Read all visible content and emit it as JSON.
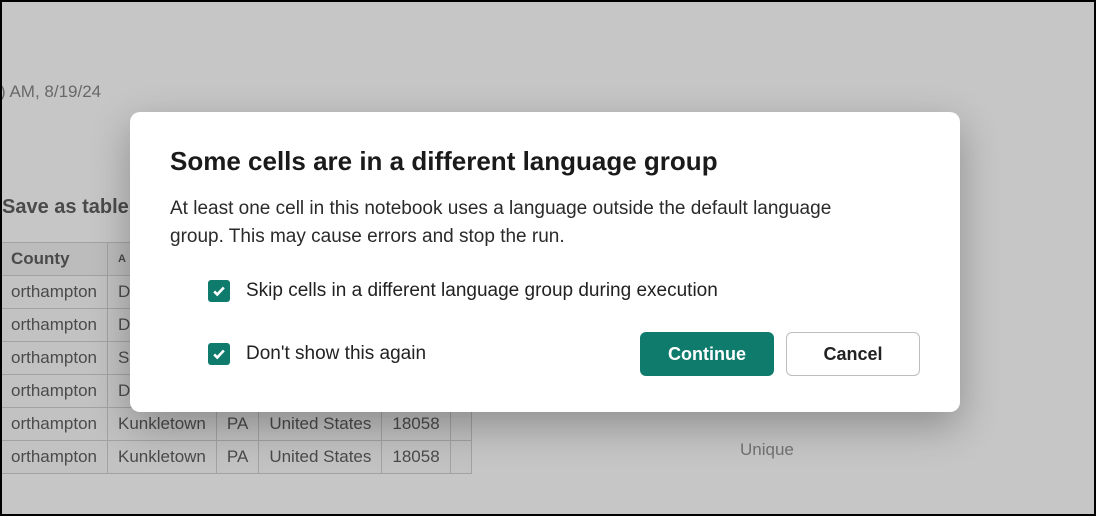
{
  "background": {
    "timestamp_partial": ") AM, 8/19/24",
    "save_as_label": "Save as table",
    "unique_label": "Unique",
    "table": {
      "headers": [
        "County",
        "A",
        "",
        "",
        "",
        ""
      ],
      "rows": [
        [
          "orthampton",
          "D",
          "",
          "",
          "",
          ""
        ],
        [
          "orthampton",
          "D",
          "",
          "",
          "",
          ""
        ],
        [
          "orthampton",
          "S",
          "",
          "",
          "",
          ""
        ],
        [
          "orthampton",
          "D",
          "",
          "",
          "",
          ""
        ],
        [
          "orthampton",
          "Kunkletown",
          "PA",
          "United States",
          "18058",
          ""
        ],
        [
          "orthampton",
          "Kunkletown",
          "PA",
          "United States",
          "18058",
          ""
        ]
      ]
    }
  },
  "dialog": {
    "title": "Some cells are in a different language group",
    "description": "At least one cell in this notebook uses a language outside the default language group. This may cause errors and stop the run.",
    "skip_checkbox": {
      "checked": true,
      "label": "Skip cells in a different language group during execution"
    },
    "dont_show_checkbox": {
      "checked": true,
      "label": "Don't show this again"
    },
    "continue_label": "Continue",
    "cancel_label": "Cancel"
  }
}
